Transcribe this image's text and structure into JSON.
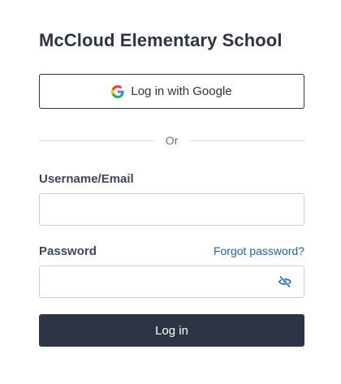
{
  "school": {
    "title": "McCloud Elementary School"
  },
  "google_login": {
    "label": "Log in with Google",
    "icon": "google-logo-icon"
  },
  "divider": {
    "text": "Or"
  },
  "username": {
    "label": "Username/Email",
    "value": "",
    "placeholder": ""
  },
  "password": {
    "label": "Password",
    "value": "",
    "placeholder": "",
    "forgot_link": "Forgot password?",
    "toggle_icon": "eye-slash-icon"
  },
  "submit": {
    "label": "Log in"
  },
  "colors": {
    "primary": "#2d3444",
    "link": "#2566a8",
    "border": "#cdd2da",
    "divider": "#d5d9e0"
  }
}
